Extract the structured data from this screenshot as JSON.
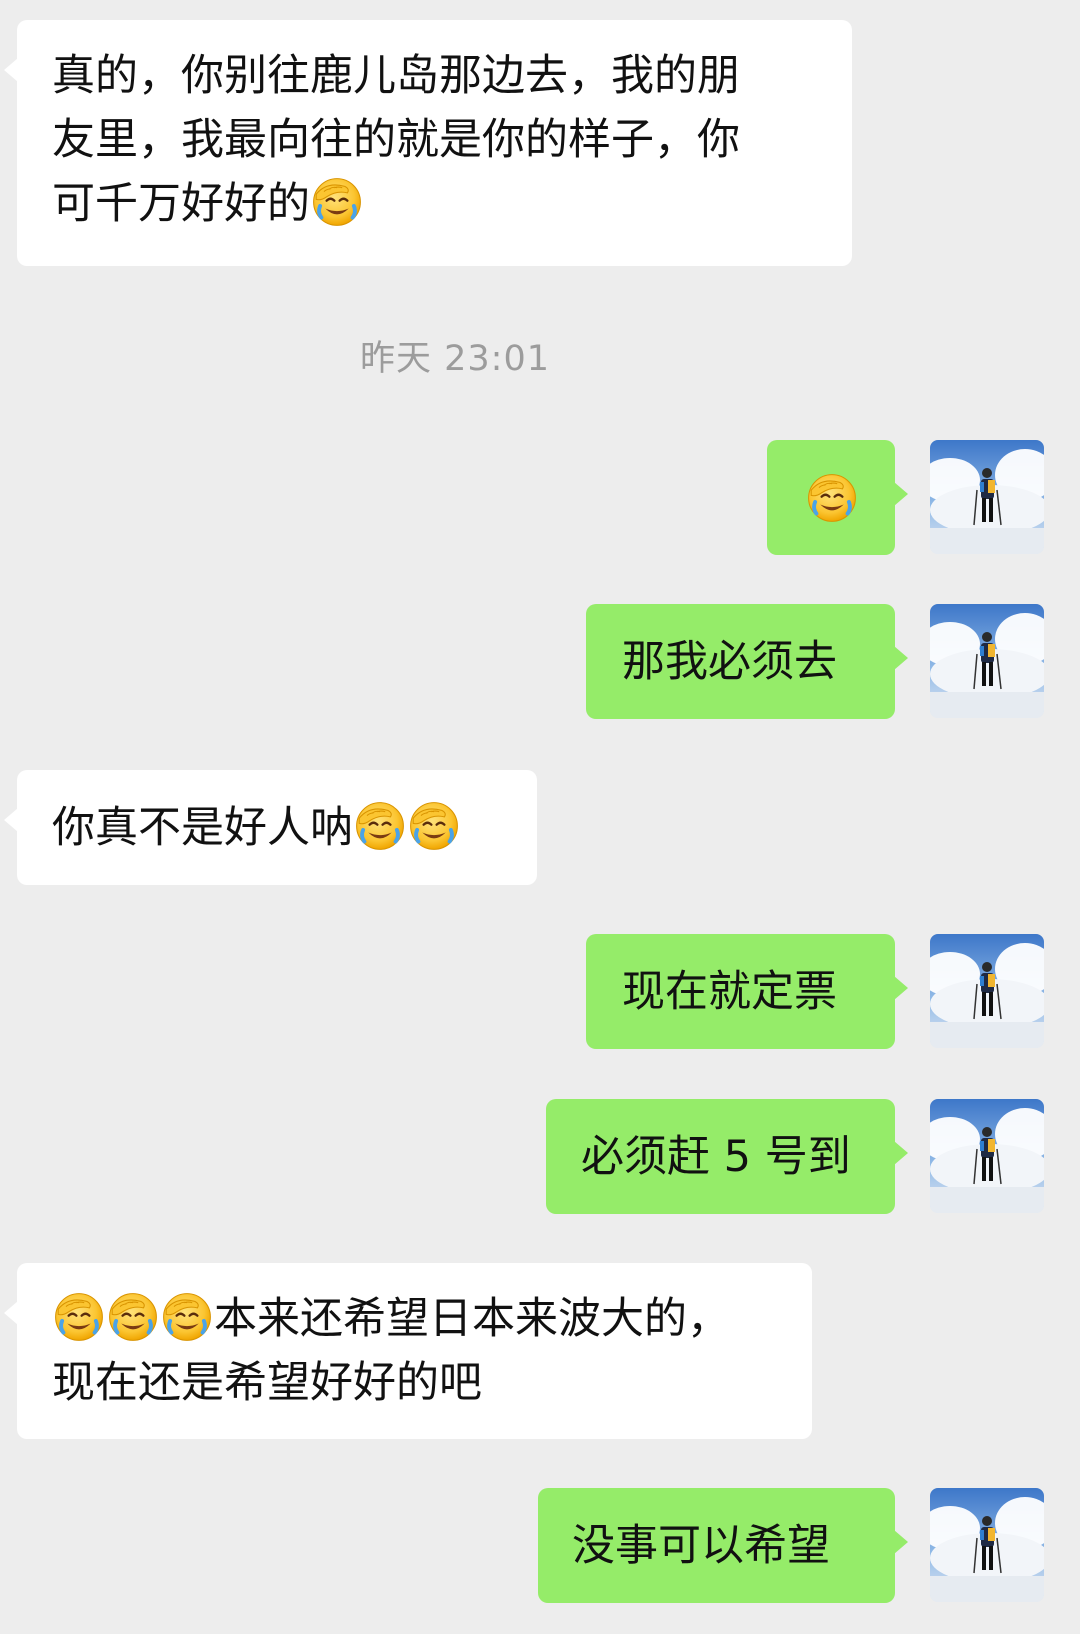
{
  "timestamp": "昨天 23:01",
  "messages": [
    {
      "side": "in",
      "parts": [
        {
          "t": "真的，你别往鹿儿岛那边去，我的朋\n友里，我最向往的就是你的样子，你\n可千万好好的"
        },
        {
          "e": "facepalm-cry-emoji"
        }
      ]
    },
    {
      "side": "out",
      "parts": [
        {
          "e": "facepalm-cry-emoji"
        }
      ]
    },
    {
      "side": "out",
      "parts": [
        {
          "t": "那我必须去"
        }
      ]
    },
    {
      "side": "in",
      "parts": [
        {
          "t": "你真不是好人呐"
        },
        {
          "e": "facepalm-cry-emoji"
        },
        {
          "e": "facepalm-cry-emoji"
        }
      ]
    },
    {
      "side": "out",
      "parts": [
        {
          "t": "现在就定票"
        }
      ]
    },
    {
      "side": "out",
      "parts": [
        {
          "t": "必须赶 5 号到"
        }
      ]
    },
    {
      "side": "in",
      "parts": [
        {
          "e": "facepalm-cry-emoji"
        },
        {
          "e": "facepalm-cry-emoji"
        },
        {
          "e": "facepalm-cry-emoji"
        },
        {
          "t": "本来还希望日本来波大的，\n现在还是希望好好的吧"
        }
      ]
    },
    {
      "side": "out",
      "parts": [
        {
          "t": "没事可以希望"
        }
      ]
    }
  ],
  "avatar_icon": "skier-avatar-icon",
  "colors": {
    "background": "#ededed",
    "incoming_bubble": "#ffffff",
    "outgoing_bubble": "#95ec69",
    "timestamp": "#9c9c9c"
  }
}
